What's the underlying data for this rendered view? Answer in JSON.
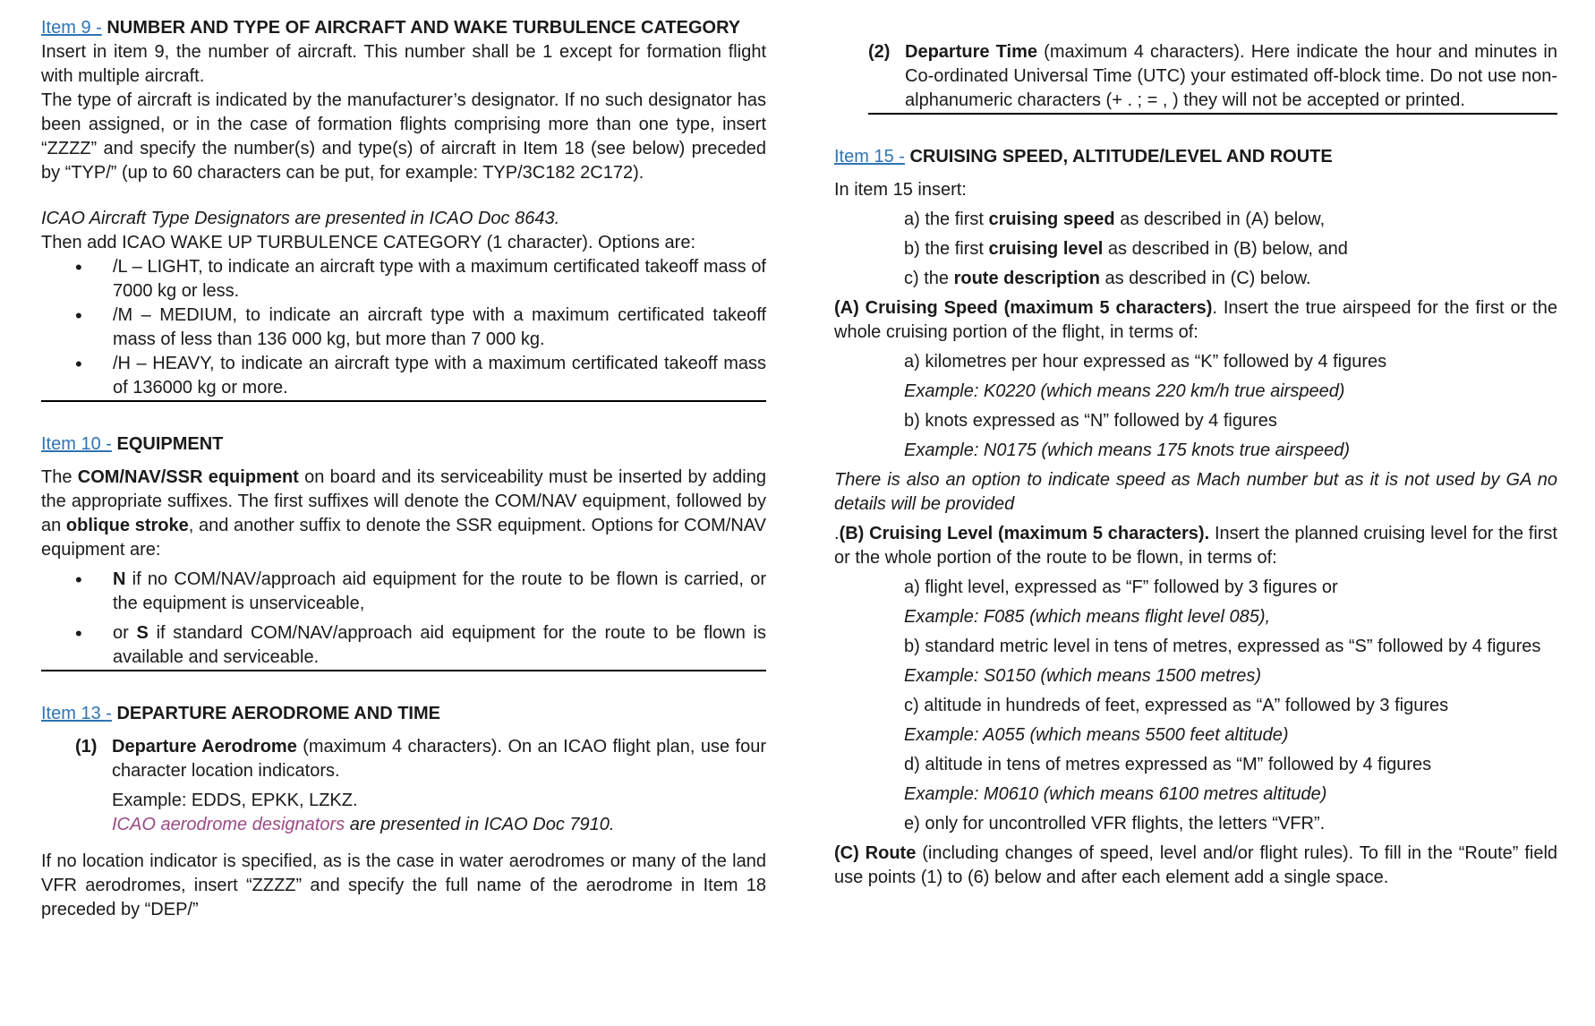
{
  "left": {
    "item9": {
      "link": "Item 9 -",
      "title": " NUMBER AND TYPE OF AIRCRAFT AND WAKE TURBULENCE CATEGORY",
      "p1": "Insert in item 9, the number of aircraft. This number shall be 1 except for formation flight with multiple aircraft.",
      "p2": "The type of aircraft is indicated by the manufacturer’s designator. If no such designator has been assigned, or in the case of formation flights comprising more than one type, insert “ZZZZ” and specify the number(s) and type(s) of aircraft in Item 18 (see below) preceded by “TYP/” (up to 60 characters can be put, for example: TYP/3C182 2C172).",
      "p3": "ICAO Aircraft Type Designators are presented in ICAO Doc 8643.",
      "p4": "Then add ICAO WAKE UP TURBULENCE CATEGORY (1 character). Options are:",
      "bullets": [
        "/L – LIGHT, to indicate an aircraft type with a maximum certificated takeoff mass of 7000 kg or less.",
        "/M – MEDIUM, to indicate an aircraft type with a maximum certificated takeoff mass of less than 136 000 kg, but more than 7 000 kg.",
        "/H – HEAVY, to indicate an aircraft type with a maximum certificated takeoff mass of 136000 kg or more."
      ]
    },
    "item10": {
      "link": "Item 10 -",
      "title": " EQUIPMENT",
      "p_a": "The ",
      "p_b": "COM/NAV/SSR equipment",
      "p_c": " on board and its serviceability must be inserted by adding the appropriate suffixes. The first suffixes will denote the COM/NAV equipment, followed by an ",
      "p_d": "oblique stroke",
      "p_e": ", and another suffix to denote the SSR equipment. Options for COM/NAV equipment are:",
      "b1_bold": "N",
      "b1_text": " if no COM/NAV/approach aid equipment for the route to be flown is carried, or the equipment is unserviceable,",
      "b2_pre": "or ",
      "b2_bold": "S",
      "b2_text": " if standard COM/NAV/approach aid equipment for the route to be flown is available and serviceable."
    },
    "item13": {
      "link": "Item 13 -",
      "title": " DEPARTURE AERODROME AND TIME",
      "n1": "(1)",
      "n1_bold": "Departure Aerodrome",
      "n1_text": " (maximum 4 characters). On an ICAO flight plan, use four character location indicators.",
      "example": "Example: EDDS, EPKK, LZKZ.",
      "link_text": "ICAO aerodrome designators",
      "link_after": " are presented in ICAO Doc 7910.",
      "p_last": "If no location indicator is specified, as is the case in water aerodromes or many of the land VFR aerodromes, insert “ZZZZ” and specify the full name of the aerodrome in Item 18 preceded by “DEP/”"
    }
  },
  "right": {
    "dep_time": {
      "num": "(2)",
      "bold": "Departure Time",
      "text": " (maximum 4 characters). Here indicate the hour and minutes in Co-ordinated Universal Time (UTC) your estimated off-block time. Do not use non-alphanumeric characters (+ . ; = , ) they will not be accepted or printed."
    },
    "item15": {
      "link": "Item 15 -",
      "title": " CRUISING SPEED, ALTITUDE/LEVEL AND ROUTE",
      "intro": "In item 15 insert:",
      "a_pre": "a) the first ",
      "a_bold": "cruising speed",
      "a_post": " as described in (A) below,",
      "b_pre": "b) the first ",
      "b_bold": "cruising level",
      "b_post": " as described in (B) below, and",
      "c_pre": "c) the ",
      "c_bold": "route description",
      "c_post": " as described in (C) below.",
      "A_bold": "(A) Cruising Speed (maximum 5 characters)",
      "A_text": ". Insert the true airspeed for the first or the whole cruising portion of the flight, in terms of:",
      "A_a": "a) kilometres per hour expressed as “K” followed by 4 figures",
      "A_a_ex": "Example: K0220 (which means 220 km/h true airspeed)",
      "A_b": "b) knots expressed as “N” followed by 4 figures",
      "A_b_ex": "Example: N0175 (which means 175 knots true airspeed)",
      "A_note": "There is also an option to indicate speed as Mach number but as it is not used by GA no details will be provided",
      "B_pre": ".",
      "B_bold": "(B) Cruising Level (maximum 5 characters).",
      "B_text": " Insert the planned cruising level for the first or the whole portion of the route to be flown, in terms of:",
      "B_a": "a) flight level, expressed as “F” followed by 3 figures or",
      "B_a_ex": "Example: F085 (which means flight level 085),",
      "B_b": "b) standard metric level in tens of metres, expressed as “S” followed by 4 figures",
      "B_b_ex": "Example: S0150 (which means 1500 metres)",
      "B_c": "c) altitude in hundreds of feet, expressed as “A” followed by 3 figures",
      "B_c_ex": "Example: A055 (which means 5500 feet altitude)",
      "B_d": "d) altitude in tens of metres expressed as “M” followed by 4 figures",
      "B_d_ex": "Example: M0610 (which means 6100 metres altitude)",
      "B_e": "e) only for uncontrolled VFR flights, the letters “VFR”.",
      "C_bold": "(C) Route",
      "C_text": " (including changes of speed, level and/or flight rules). To fill in the “Route” field use points (1) to (6) below and after each element add a single space."
    }
  }
}
